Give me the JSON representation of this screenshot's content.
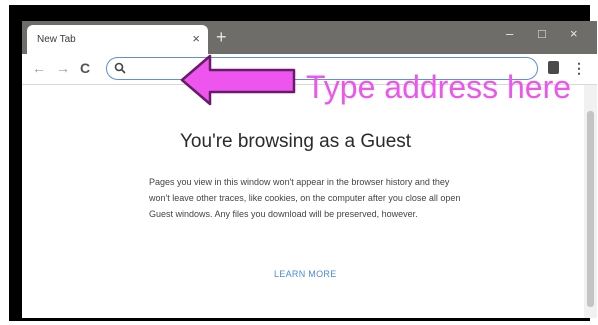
{
  "tab": {
    "title": "New Tab",
    "close_glyph": "×"
  },
  "titlebar": {
    "new_tab_glyph": "+",
    "minimize_glyph": "–",
    "maximize_glyph": "□",
    "close_glyph": "×"
  },
  "toolbar": {
    "back_glyph": "←",
    "forward_glyph": "→",
    "reload_glyph": "C",
    "omnibox": {
      "value": "",
      "placeholder": ""
    },
    "menu_glyph": "⋮"
  },
  "content": {
    "heading": "You're browsing as a Guest",
    "paragraph": "Pages you view in this window won't appear in the browser history and they won't leave other traces, like cookies, on the computer after you close all open Guest windows. Any files you download will be preserved, however.",
    "learn_more": "LEARN MORE"
  },
  "annotation": {
    "text": "Type address here",
    "color": "#ee55ee"
  },
  "colors": {
    "frame": "#000000",
    "titlebar": "#6f6d69",
    "omnibox_border": "#5f8de0",
    "link": "#4a8ae0"
  }
}
